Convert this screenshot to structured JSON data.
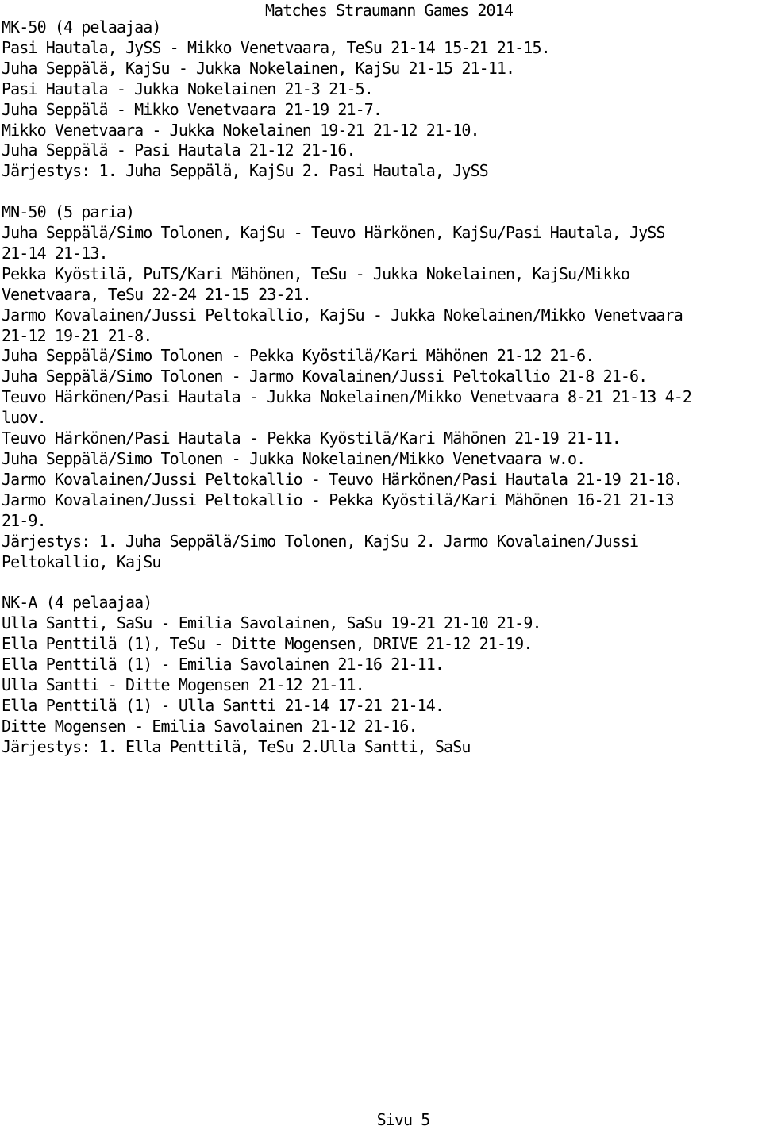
{
  "document": {
    "title": "Matches Straumann Games 2014",
    "footer": "Sivu 5",
    "sections": [
      {
        "heading": "MK-50 (4 pelaajaa)",
        "lines": [
          "Pasi Hautala, JySS - Mikko Venetvaara, TeSu 21-14 15-21 21-15.",
          "Juha Seppälä, KajSu - Jukka Nokelainen, KajSu 21-15 21-11.",
          "Pasi Hautala - Jukka Nokelainen 21-3 21-5.",
          "Juha Seppälä - Mikko Venetvaara 21-19 21-7.",
          "Mikko Venetvaara - Jukka Nokelainen 19-21 21-12 21-10.",
          "Juha Seppälä - Pasi Hautala 21-12 21-16.",
          "Järjestys: 1. Juha Seppälä, KajSu 2. Pasi Hautala, JySS"
        ]
      },
      {
        "heading": "MN-50 (5 paria)",
        "lines": [
          "Juha Seppälä/Simo Tolonen, KajSu - Teuvo Härkönen, KajSu/Pasi Hautala, JySS",
          "21-14 21-13.",
          "Pekka Kyöstilä, PuTS/Kari Mähönen, TeSu - Jukka Nokelainen, KajSu/Mikko",
          "Venetvaara, TeSu 22-24 21-15 23-21.",
          "Jarmo Kovalainen/Jussi Peltokallio, KajSu - Jukka Nokelainen/Mikko Venetvaara",
          "21-12 19-21 21-8.",
          "Juha Seppälä/Simo Tolonen - Pekka Kyöstilä/Kari Mähönen 21-12 21-6.",
          "Juha Seppälä/Simo Tolonen - Jarmo Kovalainen/Jussi Peltokallio 21-8 21-6.",
          "Teuvo Härkönen/Pasi Hautala - Jukka Nokelainen/Mikko Venetvaara 8-21 21-13 4-2",
          "luov.",
          "Teuvo Härkönen/Pasi Hautala - Pekka Kyöstilä/Kari Mähönen 21-19 21-11.",
          "Juha Seppälä/Simo Tolonen - Jukka Nokelainen/Mikko Venetvaara w.o.",
          "Jarmo Kovalainen/Jussi Peltokallio - Teuvo Härkönen/Pasi Hautala 21-19 21-18.",
          "Jarmo Kovalainen/Jussi Peltokallio - Pekka Kyöstilä/Kari Mähönen 16-21 21-13",
          "21-9.",
          "Järjestys: 1. Juha Seppälä/Simo Tolonen, KajSu 2. Jarmo Kovalainen/Jussi",
          "Peltokallio, KajSu"
        ]
      },
      {
        "heading": "NK-A (4 pelaajaa)",
        "lines": [
          "Ulla Santti, SaSu - Emilia Savolainen, SaSu 19-21 21-10 21-9.",
          "Ella Penttilä (1), TeSu - Ditte Mogensen, DRIVE 21-12 21-19.",
          "Ella Penttilä (1) - Emilia Savolainen 21-16 21-11.",
          "Ulla Santti - Ditte Mogensen 21-12 21-11.",
          "Ella Penttilä (1) - Ulla Santti 21-14 17-21 21-14.",
          "Ditte Mogensen - Emilia Savolainen 21-12 21-16.",
          "Järjestys: 1. Ella Penttilä, TeSu 2.Ulla Santti, SaSu"
        ]
      }
    ]
  }
}
